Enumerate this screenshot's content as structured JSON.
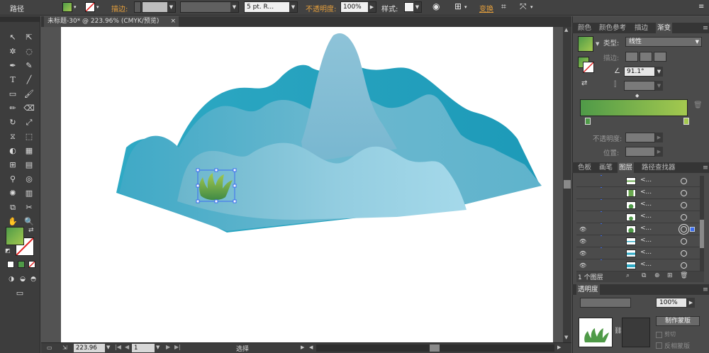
{
  "control_bar": {
    "object_type": "路径",
    "stroke_label": "描边",
    "stroke_profile": "5 pt. R...",
    "opacity_label": "不透明度",
    "opacity_value": "100%",
    "style_label": "样式",
    "transform_label": "变换"
  },
  "document": {
    "tab_title": "未标题-30* @ 223.96% (CMYK/预览)",
    "close_glyph": "×"
  },
  "status_bar": {
    "zoom": "223.96",
    "page": "1",
    "tool_status": "选择"
  },
  "color_panel": {
    "tabs": [
      "颜色",
      "颜色参考",
      "描边",
      "渐变"
    ],
    "type_label": "类型",
    "type_value": "线性",
    "stroke_label": "描边",
    "angle_value": "91.1°",
    "opacity_label": "不透明度",
    "position_label": "位置"
  },
  "layers_panel": {
    "tabs": [
      "色板",
      "画笔",
      "图层",
      "路径查找器"
    ],
    "rows": [
      {
        "name": "<...",
        "visible": false
      },
      {
        "name": "<...",
        "visible": false
      },
      {
        "name": "<...",
        "visible": false
      },
      {
        "name": "<...",
        "visible": false
      },
      {
        "name": "<...",
        "visible": true
      },
      {
        "name": "<...",
        "visible": true
      },
      {
        "name": "<...",
        "visible": true
      },
      {
        "name": "<...",
        "visible": true
      }
    ],
    "footer_count": "1 个图层"
  },
  "transparency_panel": {
    "tab": "透明度",
    "opacity_value": "100%",
    "make_mask": "制作蒙版",
    "clip_label": "剪切",
    "invert_label": "反相蒙版"
  },
  "colors": {
    "panel_bg": "#4b4b4b",
    "toolbar_bg": "#3d3d3d",
    "accent_orange": "#e8a13c",
    "grad_green_start": "#4f9a48",
    "grad_green_end": "#a4c94f",
    "mountain_back": "#2ea9c4",
    "mountain_mid": "#67b9cf",
    "mountain_front": "#9fd3e3"
  }
}
